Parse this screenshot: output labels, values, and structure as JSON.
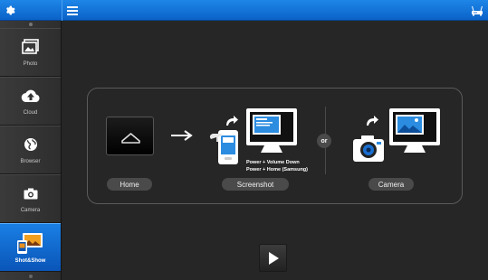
{
  "icons": {
    "settings": "gear-icon",
    "menu": "hamburger-menu-icon",
    "connection": "wifi-router-icon"
  },
  "sidebar": {
    "items": [
      {
        "label": "Photo",
        "icon": "photo-icon",
        "active": false
      },
      {
        "label": "Cloud",
        "icon": "cloud-upload-icon",
        "active": false
      },
      {
        "label": "Browser",
        "icon": "globe-icon",
        "active": false
      },
      {
        "label": "Camera",
        "icon": "camera-icon",
        "active": false
      },
      {
        "label": "Shot&Show",
        "icon": "shot-and-show-icon",
        "active": true
      }
    ]
  },
  "main": {
    "home_label": "Home",
    "screenshot_label": "Screenshot",
    "camera_label": "Camera",
    "or_label": "or",
    "hint_line1": "Power + Volume Down",
    "hint_line2": "Power + Home (Samsung)"
  },
  "colors": {
    "accent": "#0b62c8",
    "background": "#262626",
    "pill": "#4a4a4a"
  }
}
